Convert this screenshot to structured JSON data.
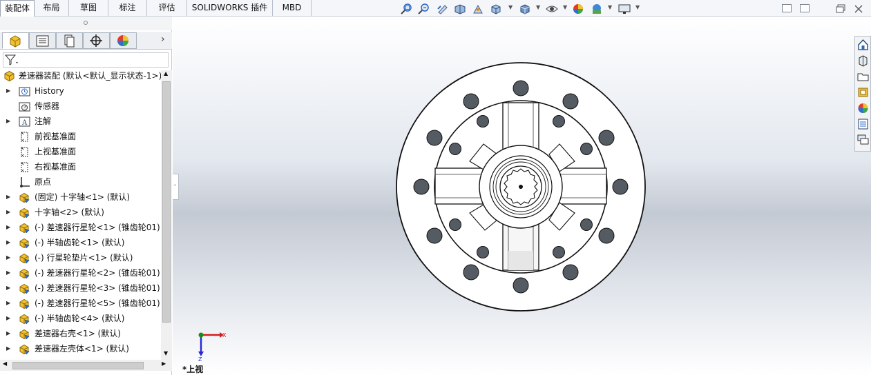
{
  "tabs": [
    "装配体",
    "布局",
    "草图",
    "标注",
    "评估",
    "SOLIDWORKS 插件",
    "MBD"
  ],
  "view_toolbar": [
    "zoom-to-fit-icon",
    "zoom-to-area-icon",
    "previous-view-icon",
    "section-view-icon",
    "instant3d-icon",
    "view-orientation-icon",
    "display-style-icon",
    "hide-show-items-icon",
    "edit-appearance-icon",
    "apply-scene-icon",
    "view-settings-icon"
  ],
  "panel_tabs": [
    "featuremanager-tab",
    "propertymanager-tab",
    "configurationmanager-tab",
    "dimxpert-tab",
    "displaymanager-tab"
  ],
  "tree": {
    "root": "差速器装配 (默认<默认_显示状态-1>)",
    "items": [
      {
        "label": "History",
        "icon": "history-icon",
        "expand": true
      },
      {
        "label": "传感器",
        "icon": "sensor-icon",
        "expand": false
      },
      {
        "label": "注解",
        "icon": "annotation-icon",
        "expand": true
      },
      {
        "label": "前视基准面",
        "icon": "plane-icon",
        "expand": false
      },
      {
        "label": "上视基准面",
        "icon": "plane-icon",
        "expand": false
      },
      {
        "label": "右视基准面",
        "icon": "plane-icon",
        "expand": false
      },
      {
        "label": "原点",
        "icon": "origin-icon",
        "expand": false
      },
      {
        "label": "(固定) 十字轴<1> (默认)",
        "icon": "part-icon",
        "expand": true
      },
      {
        "label": "十字轴<2> (默认)",
        "icon": "part-icon",
        "expand": true
      },
      {
        "label": "(-) 差速器行星轮<1> (锥齿轮01)",
        "icon": "part-icon",
        "expand": true
      },
      {
        "label": "(-) 半轴齿轮<1> (默认)",
        "icon": "part-icon",
        "expand": true
      },
      {
        "label": "(-) 行星轮垫片<1> (默认)",
        "icon": "part-icon",
        "expand": true
      },
      {
        "label": "(-) 差速器行星轮<2> (锥齿轮01)",
        "icon": "part-icon",
        "expand": true
      },
      {
        "label": "(-) 差速器行星轮<3> (锥齿轮01)",
        "icon": "part-icon",
        "expand": true
      },
      {
        "label": "(-) 差速器行星轮<5> (锥齿轮01)",
        "icon": "part-icon",
        "expand": true
      },
      {
        "label": "(-) 半轴齿轮<4> (默认)",
        "icon": "part-icon",
        "expand": true
      },
      {
        "label": "差速器右壳<1> (默认)",
        "icon": "part-icon",
        "expand": true
      },
      {
        "label": "差速器左壳体<1> (默认)",
        "icon": "part-icon",
        "expand": true
      }
    ]
  },
  "triad": {
    "x": "X",
    "z": "Z",
    "view_name": "*上视"
  },
  "task_pane": [
    "home-icon",
    "design-library-icon",
    "file-explorer-icon",
    "view-palette-icon",
    "appearances-icon",
    "custom-properties-icon",
    "forum-icon"
  ],
  "colors": {
    "viewport_top": "#ffffff",
    "viewport_mid": "#c4cad3",
    "accent": "#2a66c4",
    "axis_x": "#d01e1e",
    "axis_z": "#2a2ad0",
    "axis_y": "#1c8a1c"
  }
}
